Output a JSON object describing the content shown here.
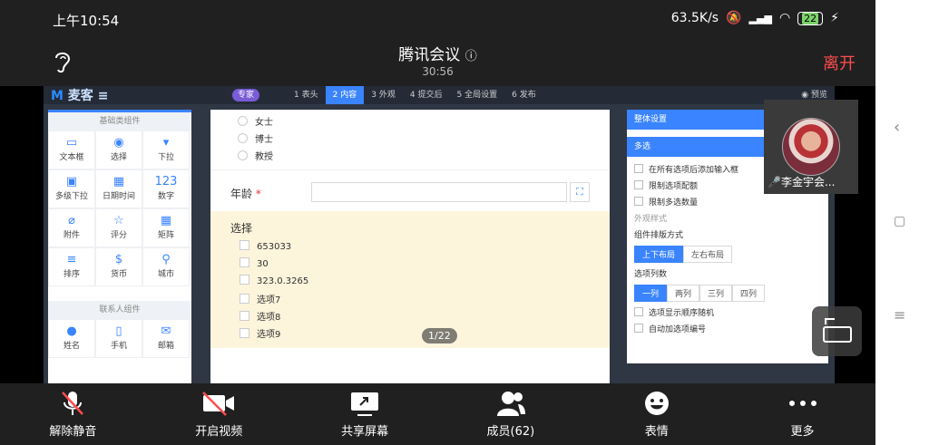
{
  "status_bar": {
    "time": "上午10:54",
    "speed": "63.5K/s",
    "battery": "22"
  },
  "meeting": {
    "title": "腾讯会议",
    "timer": "30:56",
    "leave_label": "离开",
    "page_indicator": "1/22"
  },
  "shared_app": {
    "logo_text": "麦客",
    "pro_badge": "专家",
    "steps": [
      {
        "num": "1",
        "label": "表头"
      },
      {
        "num": "2",
        "label": "内容"
      },
      {
        "num": "3",
        "label": "外观"
      },
      {
        "num": "4",
        "label": "提交后"
      },
      {
        "num": "5",
        "label": "全局设置"
      },
      {
        "num": "6",
        "label": "发布"
      }
    ],
    "preview_label": "预览",
    "left_panel": {
      "basic_header": "基础类组件",
      "basic_items": [
        {
          "icon": "▭",
          "label": "文本框"
        },
        {
          "icon": "◉",
          "label": "选择"
        },
        {
          "icon": "▾",
          "label": "下拉"
        },
        {
          "icon": "▣",
          "label": "多级下拉"
        },
        {
          "icon": "▦",
          "label": "日期时间"
        },
        {
          "icon": "123",
          "label": "数字"
        },
        {
          "icon": "⌀",
          "label": "附件"
        },
        {
          "icon": "☆",
          "label": "评分"
        },
        {
          "icon": "▦",
          "label": "矩阵"
        },
        {
          "icon": "≡",
          "label": "排序"
        },
        {
          "icon": "$",
          "label": "货币"
        },
        {
          "icon": "⚲",
          "label": "城市"
        }
      ],
      "contact_header": "联系人组件",
      "contact_items": [
        {
          "icon": "●",
          "label": "姓名"
        },
        {
          "icon": "▯",
          "label": "手机"
        },
        {
          "icon": "✉",
          "label": "邮箱"
        }
      ]
    },
    "form": {
      "radio_options": [
        "女士",
        "博士",
        "教授"
      ],
      "age_label": "年龄",
      "required_mark": "*",
      "select_title": "选择",
      "checkbox_options": [
        "653033",
        "30",
        "323.0.3265",
        "选项7",
        "选项8",
        "选项9"
      ]
    },
    "right_panel": {
      "overall_header": "整体设置",
      "multi_header": "多选",
      "checks": [
        "在所有选项后添加输入框",
        "限制选项配额",
        "限制多选数量"
      ],
      "appearance_label": "外观样式",
      "layout_label": "组件排版方式",
      "layout_options": [
        "上下布局",
        "左右布局"
      ],
      "columns_label": "选项列数",
      "column_options": [
        "一列",
        "两列",
        "三列",
        "四列"
      ],
      "checks2": [
        "选项显示顺序随机",
        "自动加选项编号"
      ]
    }
  },
  "participant": {
    "name": "李金宇会..."
  },
  "toolbar": [
    {
      "icon": "mic-muted-icon",
      "label": "解除静音"
    },
    {
      "icon": "video-off-icon",
      "label": "开启视频"
    },
    {
      "icon": "share-screen-icon",
      "label": "共享屏幕"
    },
    {
      "icon": "members-icon",
      "label": "成员(62)"
    },
    {
      "icon": "emoji-icon",
      "label": "表情"
    },
    {
      "icon": "more-icon",
      "label": "更多"
    }
  ]
}
